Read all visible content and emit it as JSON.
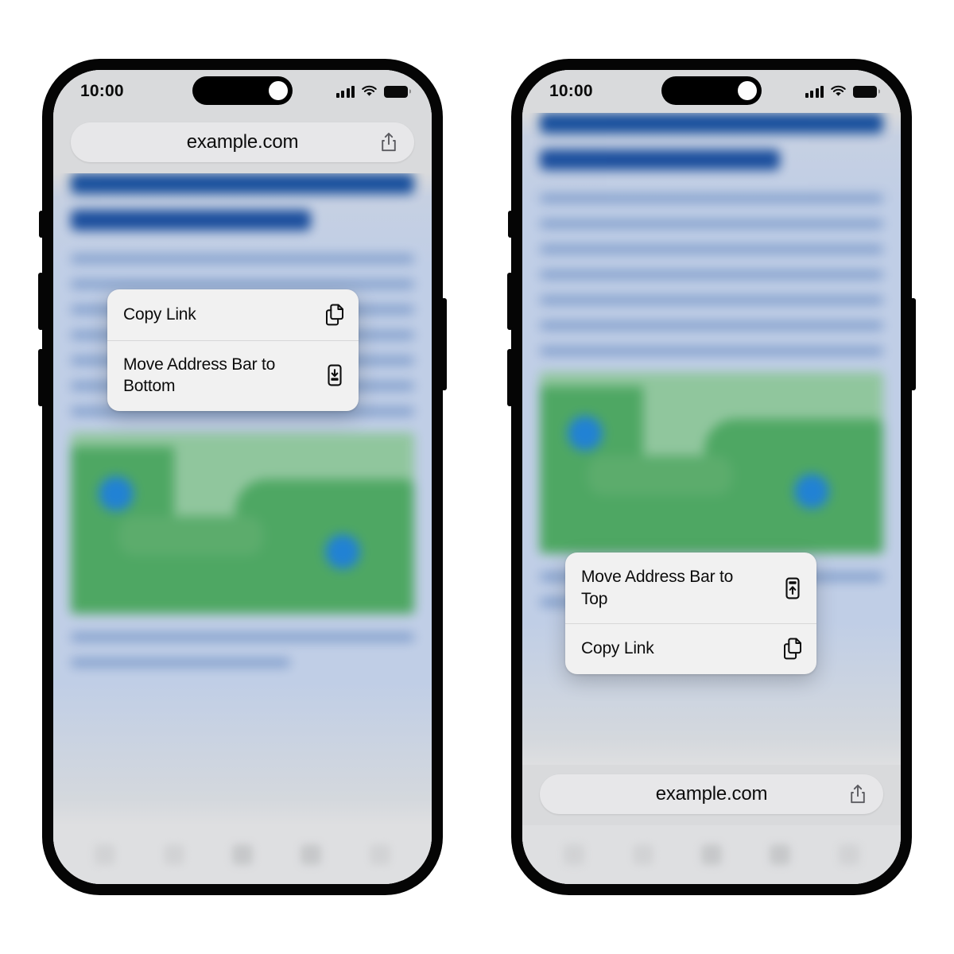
{
  "meta": {
    "illustration_title": "Safari address bar position toggle",
    "phone_count": 2
  },
  "phones": [
    {
      "id": "phone-top-address-bar",
      "address_bar_position": "top",
      "status_bar": {
        "time": "10:00",
        "signal_icon": "cellular-signal-icon",
        "signal_bars": 4,
        "wifi_icon": "wifi-icon",
        "battery_icon": "battery-full-icon"
      },
      "address_bar": {
        "url": "example.com",
        "share_icon": "share-icon"
      },
      "context_menu": {
        "items": [
          {
            "label": "Copy Link",
            "icon": "copy-documents-icon"
          },
          {
            "label": "Move Address Bar to Bottom",
            "icon": "move-bar-bottom-icon"
          }
        ]
      },
      "toolbar": {
        "icons": [
          "back-icon",
          "forward-icon",
          "share-icon",
          "bookmarks-icon",
          "tabs-icon"
        ]
      },
      "content": {
        "heading_bars": 2,
        "text_lines": 9,
        "map_block": {
          "pins": 2,
          "pin_color": "#1b7fd4",
          "land_color": "#4aa65e",
          "water_color": "#8fc69b"
        },
        "footer_lines": 2
      }
    },
    {
      "id": "phone-bottom-address-bar",
      "address_bar_position": "bottom",
      "status_bar": {
        "time": "10:00",
        "signal_icon": "cellular-signal-icon",
        "signal_bars": 4,
        "wifi_icon": "wifi-icon",
        "battery_icon": "battery-full-icon"
      },
      "address_bar": {
        "url": "example.com",
        "share_icon": "share-icon"
      },
      "context_menu": {
        "items": [
          {
            "label": "Move Address Bar to Top",
            "icon": "move-bar-top-icon"
          },
          {
            "label": "Copy Link",
            "icon": "copy-documents-icon"
          }
        ]
      },
      "toolbar": {
        "icons": [
          "back-icon",
          "forward-icon",
          "share-icon",
          "bookmarks-icon",
          "tabs-icon"
        ]
      },
      "content": {
        "heading_bars": 2,
        "text_lines": 9,
        "map_block": {
          "pins": 2,
          "pin_color": "#1b7fd4",
          "land_color": "#4aa65e",
          "water_color": "#8fc69b"
        },
        "footer_lines": 0
      }
    }
  ],
  "colors": {
    "frame": "#050505",
    "screen_chrome": "#d9dadc",
    "address_bar_fill": "#e7e7e9",
    "menu_fill": "#f1f1f1",
    "heading_blue": "#114a9a",
    "text_blue": "#7e9ccb",
    "page_blue": "#c0cee6"
  }
}
